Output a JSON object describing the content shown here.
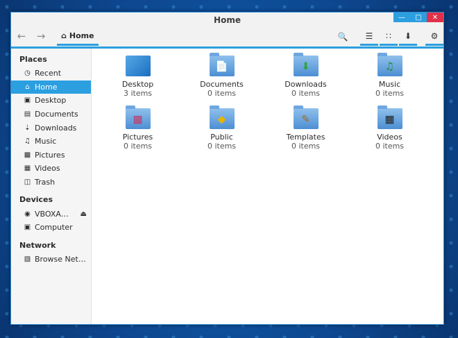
{
  "window": {
    "title": "Home"
  },
  "toolbar": {
    "path_label": "Home"
  },
  "sidebar": {
    "places_heading": "Places",
    "places": [
      {
        "label": "Recent",
        "icon": "clock-icon"
      },
      {
        "label": "Home",
        "icon": "home-icon",
        "selected": true
      },
      {
        "label": "Desktop",
        "icon": "desktop-icon"
      },
      {
        "label": "Documents",
        "icon": "document-icon"
      },
      {
        "label": "Downloads",
        "icon": "download-icon"
      },
      {
        "label": "Music",
        "icon": "music-icon"
      },
      {
        "label": "Pictures",
        "icon": "picture-icon"
      },
      {
        "label": "Videos",
        "icon": "film-icon"
      },
      {
        "label": "Trash",
        "icon": "trash-icon"
      }
    ],
    "devices_heading": "Devices",
    "devices": [
      {
        "label": "VBOXA…",
        "icon": "disc-icon"
      },
      {
        "label": "Computer",
        "icon": "computer-icon"
      }
    ],
    "network_heading": "Network",
    "network": [
      {
        "label": "Browse Net…",
        "icon": "network-icon"
      }
    ]
  },
  "files": [
    {
      "name": "Desktop",
      "count": "3 items"
    },
    {
      "name": "Documents",
      "count": "0 items"
    },
    {
      "name": "Downloads",
      "count": "0 items"
    },
    {
      "name": "Music",
      "count": "0 items"
    },
    {
      "name": "Pictures",
      "count": "0 items"
    },
    {
      "name": "Public",
      "count": "0 items"
    },
    {
      "name": "Templates",
      "count": "0 items"
    },
    {
      "name": "Videos",
      "count": "0 items"
    }
  ],
  "colors": {
    "accent": "#2b9fe0",
    "close": "#e0304a"
  }
}
